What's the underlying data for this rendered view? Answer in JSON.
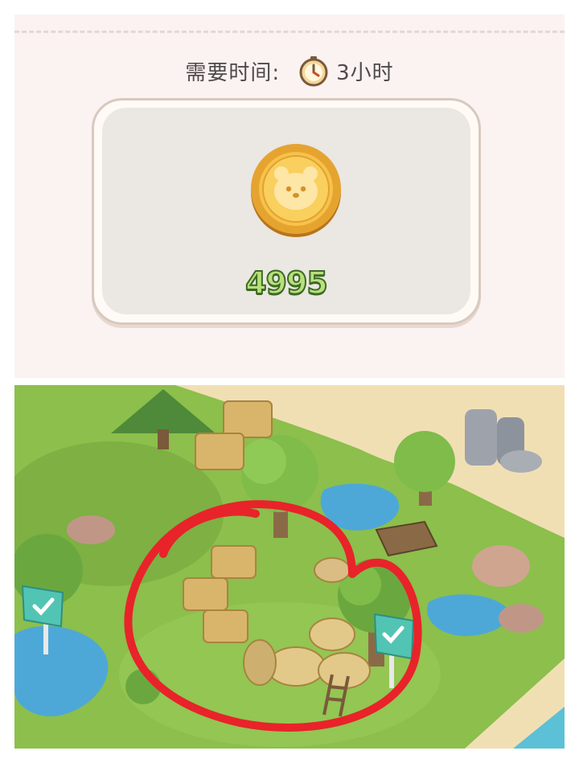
{
  "requirement": {
    "time_label": "需要时间:",
    "time_icon": "stopwatch-icon",
    "time_value": "3小时"
  },
  "reward": {
    "icon": "bear-coin-icon",
    "amount": "4995",
    "amount_color": "#b8e07a"
  },
  "scene": {
    "description_icons": [
      "check-sign-icon",
      "check-sign-icon"
    ],
    "highlight_color": "#e8232a"
  }
}
